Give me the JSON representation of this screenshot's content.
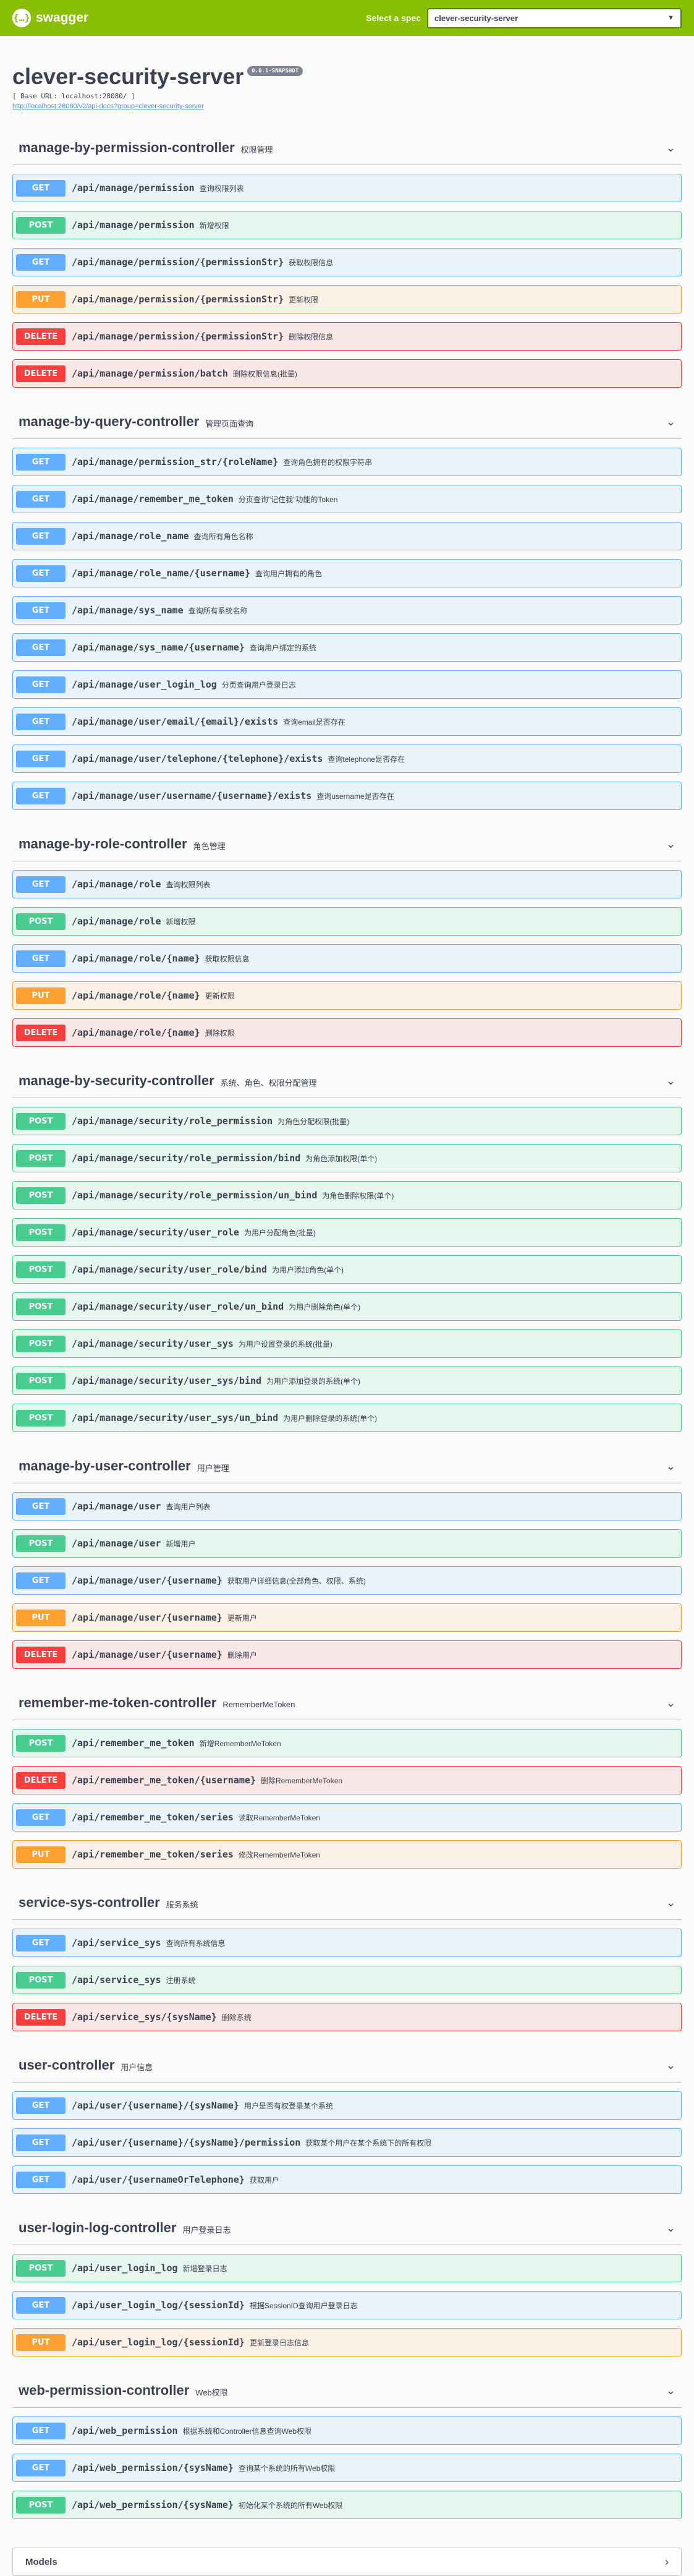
{
  "topbar": {
    "logo_mark": "{…}",
    "logo_text": "swagger",
    "spec_label": "Select a spec",
    "spec_value": "clever-security-server",
    "select_icon": "chevron-down-icon"
  },
  "info": {
    "title": "clever-security-server",
    "version": "0.0.1-SNAPSHOT",
    "base_url": "[ Base URL: localhost:28080/ ]",
    "docs_url": "http://localhost:28080/v2/api-docs?group=clever-security-server"
  },
  "tags": [
    {
      "name": "manage-by-permission-controller",
      "description": "权限管理",
      "ops": [
        {
          "method": "GET",
          "path": "/api/manage/permission",
          "summary": "查询权限列表"
        },
        {
          "method": "POST",
          "path": "/api/manage/permission",
          "summary": "新增权限"
        },
        {
          "method": "GET",
          "path": "/api/manage/permission/{permissionStr}",
          "summary": "获取权限信息"
        },
        {
          "method": "PUT",
          "path": "/api/manage/permission/{permissionStr}",
          "summary": "更新权限"
        },
        {
          "method": "DELETE",
          "path": "/api/manage/permission/{permissionStr}",
          "summary": "删除权限信息"
        },
        {
          "method": "DELETE",
          "path": "/api/manage/permission/batch",
          "summary": "删除权限信息(批量)"
        }
      ]
    },
    {
      "name": "manage-by-query-controller",
      "description": "管理页面查询",
      "ops": [
        {
          "method": "GET",
          "path": "/api/manage/permission_str/{roleName}",
          "summary": "查询角色拥有的权限字符串"
        },
        {
          "method": "GET",
          "path": "/api/manage/remember_me_token",
          "summary": "分页查询\"记住我\"功能的Token"
        },
        {
          "method": "GET",
          "path": "/api/manage/role_name",
          "summary": "查询所有角色名称"
        },
        {
          "method": "GET",
          "path": "/api/manage/role_name/{username}",
          "summary": "查询用户拥有的角色"
        },
        {
          "method": "GET",
          "path": "/api/manage/sys_name",
          "summary": "查询所有系统名称"
        },
        {
          "method": "GET",
          "path": "/api/manage/sys_name/{username}",
          "summary": "查询用户绑定的系统"
        },
        {
          "method": "GET",
          "path": "/api/manage/user_login_log",
          "summary": "分页查询用户登录日志"
        },
        {
          "method": "GET",
          "path": "/api/manage/user/email/{email}/exists",
          "summary": "查询email是否存在"
        },
        {
          "method": "GET",
          "path": "/api/manage/user/telephone/{telephone}/exists",
          "summary": "查询telephone是否存在"
        },
        {
          "method": "GET",
          "path": "/api/manage/user/username/{username}/exists",
          "summary": "查询username是否存在"
        }
      ]
    },
    {
      "name": "manage-by-role-controller",
      "description": "角色管理",
      "ops": [
        {
          "method": "GET",
          "path": "/api/manage/role",
          "summary": "查询权限列表"
        },
        {
          "method": "POST",
          "path": "/api/manage/role",
          "summary": "新增权限"
        },
        {
          "method": "GET",
          "path": "/api/manage/role/{name}",
          "summary": "获取权限信息"
        },
        {
          "method": "PUT",
          "path": "/api/manage/role/{name}",
          "summary": "更新权限"
        },
        {
          "method": "DELETE",
          "path": "/api/manage/role/{name}",
          "summary": "删除权限"
        }
      ]
    },
    {
      "name": "manage-by-security-controller",
      "description": "系统、角色、权限分配管理",
      "ops": [
        {
          "method": "POST",
          "path": "/api/manage/security/role_permission",
          "summary": "为角色分配权限(批量)"
        },
        {
          "method": "POST",
          "path": "/api/manage/security/role_permission/bind",
          "summary": "为角色添加权限(单个)"
        },
        {
          "method": "POST",
          "path": "/api/manage/security/role_permission/un_bind",
          "summary": "为角色删除权限(单个)"
        },
        {
          "method": "POST",
          "path": "/api/manage/security/user_role",
          "summary": "为用户分配角色(批量)"
        },
        {
          "method": "POST",
          "path": "/api/manage/security/user_role/bind",
          "summary": "为用户添加角色(单个)"
        },
        {
          "method": "POST",
          "path": "/api/manage/security/user_role/un_bind",
          "summary": "为用户删除角色(单个)"
        },
        {
          "method": "POST",
          "path": "/api/manage/security/user_sys",
          "summary": "为用户设置登录的系统(批量)"
        },
        {
          "method": "POST",
          "path": "/api/manage/security/user_sys/bind",
          "summary": "为用户添加登录的系统(单个)"
        },
        {
          "method": "POST",
          "path": "/api/manage/security/user_sys/un_bind",
          "summary": "为用户删除登录的系统(单个)"
        }
      ]
    },
    {
      "name": "manage-by-user-controller",
      "description": "用户管理",
      "ops": [
        {
          "method": "GET",
          "path": "/api/manage/user",
          "summary": "查询用户列表"
        },
        {
          "method": "POST",
          "path": "/api/manage/user",
          "summary": "新增用户"
        },
        {
          "method": "GET",
          "path": "/api/manage/user/{username}",
          "summary": "获取用户详细信息(全部角色、权限、系统)"
        },
        {
          "method": "PUT",
          "path": "/api/manage/user/{username}",
          "summary": "更新用户"
        },
        {
          "method": "DELETE",
          "path": "/api/manage/user/{username}",
          "summary": "删除用户"
        }
      ]
    },
    {
      "name": "remember-me-token-controller",
      "description": "RememberMeToken",
      "ops": [
        {
          "method": "POST",
          "path": "/api/remember_me_token",
          "summary": "新增RememberMeToken"
        },
        {
          "method": "DELETE",
          "path": "/api/remember_me_token/{username}",
          "summary": "删除RememberMeToken"
        },
        {
          "method": "GET",
          "path": "/api/remember_me_token/series",
          "summary": "读取RememberMeToken"
        },
        {
          "method": "PUT",
          "path": "/api/remember_me_token/series",
          "summary": "修改RememberMeToken"
        }
      ]
    },
    {
      "name": "service-sys-controller",
      "description": "服务系统",
      "ops": [
        {
          "method": "GET",
          "path": "/api/service_sys",
          "summary": "查询所有系统信息"
        },
        {
          "method": "POST",
          "path": "/api/service_sys",
          "summary": "注册系统"
        },
        {
          "method": "DELETE",
          "path": "/api/service_sys/{sysName}",
          "summary": "删除系统"
        }
      ]
    },
    {
      "name": "user-controller",
      "description": "用户信息",
      "ops": [
        {
          "method": "GET",
          "path": "/api/user/{username}/{sysName}",
          "summary": "用户是否有权登录某个系统"
        },
        {
          "method": "GET",
          "path": "/api/user/{username}/{sysName}/permission",
          "summary": "获取某个用户在某个系统下的所有权限"
        },
        {
          "method": "GET",
          "path": "/api/user/{usernameOrTelephone}",
          "summary": "获取用户"
        }
      ]
    },
    {
      "name": "user-login-log-controller",
      "description": "用户登录日志",
      "ops": [
        {
          "method": "POST",
          "path": "/api/user_login_log",
          "summary": "新增登录日志"
        },
        {
          "method": "GET",
          "path": "/api/user_login_log/{sessionId}",
          "summary": "根据SessionID查询用户登录日志"
        },
        {
          "method": "PUT",
          "path": "/api/user_login_log/{sessionId}",
          "summary": "更新登录日志信息"
        }
      ]
    },
    {
      "name": "web-permission-controller",
      "description": "Web权限",
      "ops": [
        {
          "method": "GET",
          "path": "/api/web_permission",
          "summary": "根据系统和Controller信息查询Web权限"
        },
        {
          "method": "GET",
          "path": "/api/web_permission/{sysName}",
          "summary": "查询某个系统的所有Web权限"
        },
        {
          "method": "POST",
          "path": "/api/web_permission/{sysName}",
          "summary": "初始化某个系统的所有Web权限"
        }
      ]
    }
  ],
  "models": {
    "title": "Models"
  },
  "colors": {
    "topbar": "#89bf04",
    "get": "#61affe",
    "post": "#49cc90",
    "put": "#fca130",
    "delete": "#f93e3e"
  }
}
